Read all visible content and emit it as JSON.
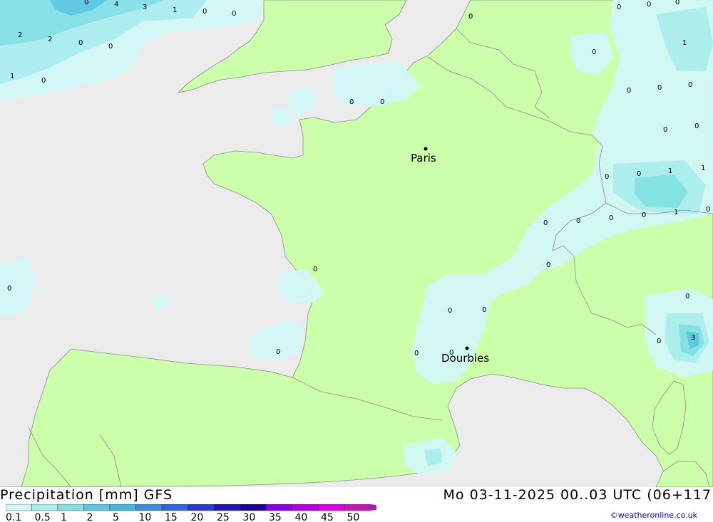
{
  "map": {
    "colors": {
      "sea": "#ebebeb",
      "land": "#ccffaa",
      "precip_0_1": "#d2f7f7",
      "precip_0_5": "#aaeef0",
      "precip_1": "#82e1e6",
      "precip_2": "#5ac8e1",
      "border": "#8c8c8c"
    },
    "cities": [
      {
        "name": "Paris"
      },
      {
        "name": "Dourbies"
      }
    ],
    "values": [
      "0",
      "4",
      "3",
      "1",
      "0",
      "0",
      "2",
      "2",
      "0",
      "0",
      "1",
      "0",
      "0",
      "0",
      "0",
      "0",
      "1",
      "0",
      "0",
      "0",
      "0",
      "0",
      "0",
      "0",
      "0",
      "1",
      "1",
      "0",
      "1",
      "0",
      "0",
      "0",
      "0",
      "0",
      "0",
      "0",
      "0",
      "0",
      "0",
      "0",
      "0",
      "0",
      "0",
      "3",
      "0",
      "0",
      "0",
      "0"
    ]
  },
  "footer": {
    "title": "Precipitation [mm] GFS",
    "datetime": "Mo 03-11-2025 00..03 UTC (06+117",
    "credit": "©weatheronline.co.uk"
  },
  "legend": {
    "labels": [
      "0.1",
      "0.5",
      "1",
      "2",
      "5",
      "10",
      "15",
      "20",
      "25",
      "30",
      "35",
      "40",
      "45",
      "50"
    ],
    "colors": [
      "#d2f7f7",
      "#aaeef0",
      "#82e1e6",
      "#5ac8e1",
      "#46b4e1",
      "#3c8ce1",
      "#3264dc",
      "#283cc8",
      "#1e14b4",
      "#1e0096",
      "#8c00e6",
      "#b400e6",
      "#dc00e6",
      "#c814b4",
      "#a01eaa"
    ]
  }
}
